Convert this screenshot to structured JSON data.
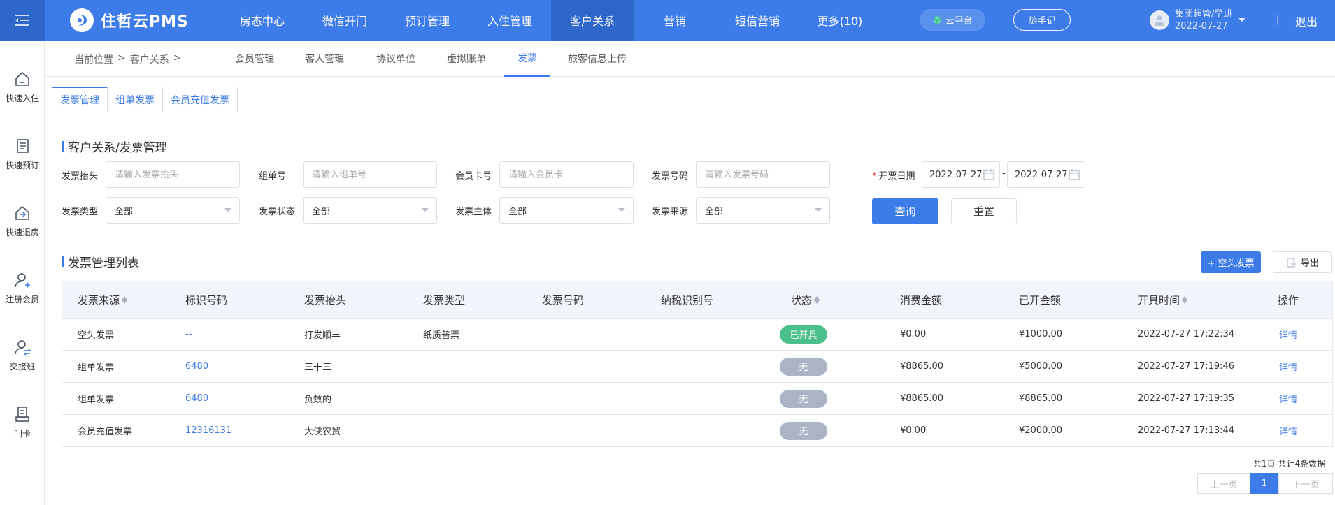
{
  "topbar": {
    "logo_text": "住哲云PMS",
    "nav": [
      "房态中心",
      "微信开门",
      "预订管理",
      "入住管理",
      "客户关系",
      "营销",
      "短信营销",
      "更多(10)"
    ],
    "active_nav": "客户关系",
    "cloud_label": "云平台",
    "memo_label": "随手记",
    "user_name": "集团超管/早班",
    "user_date": "2022-07-27",
    "logout_label": "退出"
  },
  "sidebar": {
    "items": [
      {
        "label": "快速入住",
        "icon": "home-enter-icon"
      },
      {
        "label": "快速预订",
        "icon": "document-list-icon"
      },
      {
        "label": "快速退房",
        "icon": "home-exit-icon"
      },
      {
        "label": "注册会员",
        "icon": "user-add-icon"
      },
      {
        "label": "交接班",
        "icon": "user-swap-icon"
      },
      {
        "label": "门卡",
        "icon": "card-icon"
      }
    ]
  },
  "breadcrumb": {
    "prefix": "当前位置",
    "sep": ">",
    "section": "客户关系",
    "trail": ">"
  },
  "subtabs": [
    "会员管理",
    "客人管理",
    "协议单位",
    "虚拟账单",
    "发票",
    "旅客信息上传"
  ],
  "active_subtab": "发票",
  "page_tabs": [
    "发票管理",
    "组单发票",
    "会员充值发票"
  ],
  "filter": {
    "title": "客户关系/发票管理",
    "invoice_head_label": "发票抬头",
    "invoice_head_placeholder": "请输入发票抬头",
    "group_no_label": "组单号",
    "group_no_placeholder": "请输入组单号",
    "member_card_label": "会员卡号",
    "member_card_placeholder": "请输入会员卡",
    "invoice_no_label": "发票号码",
    "invoice_no_placeholder": "请输入发票号码",
    "date_label": "开票日期",
    "date_required_mark": "*",
    "date_start": "2022-07-27",
    "date_sep": "-",
    "date_end": "2022-07-27",
    "type_label": "发票类型",
    "type_value": "全部",
    "status_label": "发票状态",
    "status_value": "全部",
    "subject_label": "发票主体",
    "subject_value": "全部",
    "source_label": "发票来源",
    "source_value": "全部",
    "search_btn": "查询",
    "reset_btn": "重置"
  },
  "list": {
    "title": "发票管理列表",
    "add_btn": "+ 空头发票",
    "export_btn": "导出",
    "columns": [
      "发票来源",
      "标识号码",
      "发票抬头",
      "发票类型",
      "发票号码",
      "纳税识别号",
      "状态",
      "消费金额",
      "已开金额",
      "开具时间",
      "操作"
    ],
    "rows": [
      {
        "source": "空头发票",
        "id": "--",
        "head": "打发顺丰",
        "type": "纸质普票",
        "no": "",
        "tax": "",
        "status": "已开具",
        "status_color": "#4cc08a",
        "consume": "¥0.00",
        "issued": "¥1000.00",
        "time": "2022-07-27 17:22:34",
        "action": "详情"
      },
      {
        "source": "组单发票",
        "id": "6480",
        "head": "三十三",
        "type": "",
        "no": "",
        "tax": "",
        "status": "无",
        "status_color": "#aab4c5",
        "consume": "¥8865.00",
        "issued": "¥5000.00",
        "time": "2022-07-27 17:19:46",
        "action": "详情"
      },
      {
        "source": "组单发票",
        "id": "6480",
        "head": "负数的",
        "type": "",
        "no": "",
        "tax": "",
        "status": "无",
        "status_color": "#aab4c5",
        "consume": "¥8865.00",
        "issued": "¥8865.00",
        "time": "2022-07-27 17:19:35",
        "action": "详情"
      },
      {
        "source": "会员充值发票",
        "id": "12316131",
        "head": "大侠农贸",
        "type": "",
        "no": "",
        "tax": "",
        "status": "无",
        "status_color": "#aab4c5",
        "consume": "¥0.00",
        "issued": "¥2000.00",
        "time": "2022-07-27 17:13:44",
        "action": "详情"
      }
    ]
  },
  "pager": {
    "info": "共1页 共计4条数据",
    "prev": "上一页",
    "current": "1",
    "next": "下一页"
  },
  "colors": {
    "primary": "#3d7ce8",
    "nav_active": "#2f66c9",
    "success": "#4cc08a",
    "muted": "#aab4c5"
  }
}
